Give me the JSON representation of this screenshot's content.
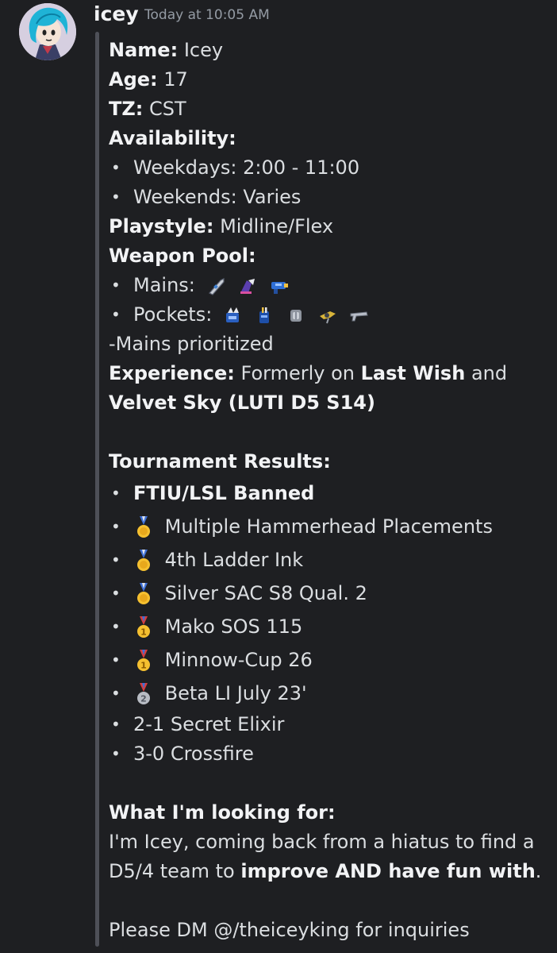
{
  "message": {
    "username": "icey",
    "timestamp": "Today at 10:05 AM"
  },
  "profile": {
    "name_label": "Name:",
    "name_value": "Icey",
    "age_label": "Age:",
    "age_value": "17",
    "tz_label": "TZ:",
    "tz_value": "CST",
    "availability_label": "Availability:",
    "availability": [
      "Weekdays: 2:00 - 11:00",
      "Weekends: Varies"
    ],
    "playstyle_label": "Playstyle:",
    "playstyle_value": "Midline/Flex",
    "weapon_pool_label": "Weapon Pool:",
    "mains_label": "Mains:",
    "mains_icons": [
      "weapon-icon-1",
      "weapon-icon-2",
      "weapon-icon-3"
    ],
    "pockets_label": "Pockets:",
    "pockets_icons": [
      "weapon-icon-4",
      "weapon-icon-5",
      "weapon-icon-6",
      "weapon-icon-7",
      "weapon-icon-8"
    ],
    "mains_note": "-Mains prioritized",
    "experience_label": "Experience:",
    "experience_prefix": "Formerly on",
    "team_1": "Last Wish",
    "experience_and": "and",
    "team_2": "Velvet Sky (LUTI D5 S14)"
  },
  "tournament": {
    "label": "Tournament Results:",
    "banned": "FTIU/LSL Banned",
    "results": [
      {
        "medal": "sports-medal-icon",
        "text": "Multiple Hammerhead Placements"
      },
      {
        "medal": "sports-medal-icon",
        "text": "4th Ladder Ink"
      },
      {
        "medal": "sports-medal-icon",
        "text": "Silver SAC S8 Qual. 2"
      },
      {
        "medal": "first-place-medal-icon",
        "text": "Mako SOS 115"
      },
      {
        "medal": "first-place-medal-icon",
        "text": "Minnow-Cup 26"
      },
      {
        "medal": "second-place-medal-icon",
        "text": "Beta LI July 23'"
      }
    ],
    "plain_results": [
      "2-1 Secret Elixir",
      "3-0 Crossfire"
    ]
  },
  "looking_for": {
    "label": "What I'm looking for:",
    "intro": "I'm Icey, coming back from a hiatus to find a D5/4 team to",
    "emphasis": "improve AND have fun with",
    "end": ".",
    "contact": "Please DM @/theiceyking for inquiries"
  },
  "colors": {
    "background": "#1e1f22",
    "text": "#dbdee1",
    "bold_text": "#f2f3f5",
    "muted": "#949ba4",
    "quote_bar": "#4e5058"
  }
}
